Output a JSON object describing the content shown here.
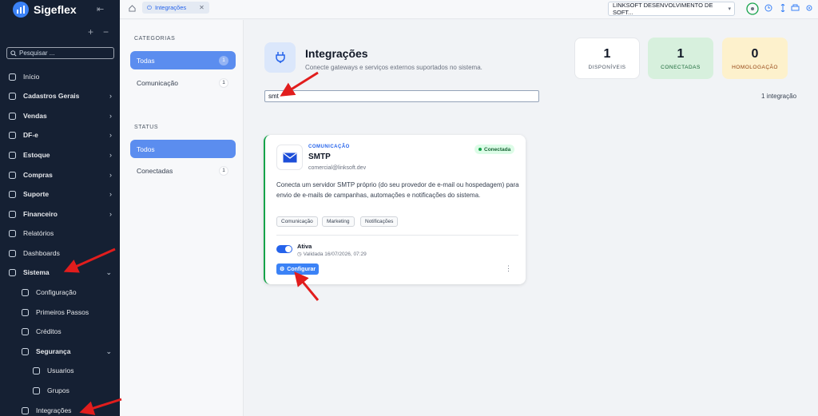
{
  "app": {
    "name": "Sigeflex"
  },
  "sidebar": {
    "search_placeholder": "Pesquisar ...",
    "items": [
      {
        "label": "Início",
        "icon": "home-icon",
        "bold": false,
        "chevron": ""
      },
      {
        "label": "Cadastros Gerais",
        "icon": "grid-icon",
        "bold": true,
        "chevron": "›"
      },
      {
        "label": "Vendas",
        "icon": "cart-icon",
        "bold": true,
        "chevron": "›"
      },
      {
        "label": "DF-e",
        "icon": "document-icon",
        "bold": true,
        "chevron": "›"
      },
      {
        "label": "Estoque",
        "icon": "box-icon",
        "bold": true,
        "chevron": "›"
      },
      {
        "label": "Compras",
        "icon": "truck-icon",
        "bold": true,
        "chevron": "›"
      },
      {
        "label": "Suporte",
        "icon": "headset-icon",
        "bold": true,
        "chevron": "›"
      },
      {
        "label": "Financeiro",
        "icon": "bank-icon",
        "bold": true,
        "chevron": "›"
      },
      {
        "label": "Relatórios",
        "icon": "report-icon",
        "bold": false,
        "chevron": ""
      },
      {
        "label": "Dashboards",
        "icon": "dashboard-icon",
        "bold": false,
        "chevron": ""
      },
      {
        "label": "Sistema",
        "icon": "gear-icon",
        "bold": true,
        "chevron": "⌄"
      },
      {
        "label": "Configuração",
        "icon": "gear-icon",
        "bold": false,
        "chevron": ""
      },
      {
        "label": "Primeiros Passos",
        "icon": "rocket-icon",
        "bold": false,
        "chevron": ""
      },
      {
        "label": "Créditos",
        "icon": "coins-icon",
        "bold": false,
        "chevron": ""
      },
      {
        "label": "Segurança",
        "icon": "shield-icon",
        "bold": true,
        "chevron": "⌄"
      },
      {
        "label": "Usuarios",
        "icon": "user-icon",
        "bold": false,
        "chevron": ""
      },
      {
        "label": "Grupos",
        "icon": "users-icon",
        "bold": false,
        "chevron": ""
      },
      {
        "label": "Integrações",
        "icon": "plug-icon",
        "bold": false,
        "chevron": ""
      }
    ]
  },
  "topbar": {
    "tab_label": "Integrações",
    "company": "LINKSOFT DESENVOLVIMENTO DE SOFT..."
  },
  "filters": {
    "categories_title": "CATEGORIAS",
    "categories": [
      {
        "label": "Todas",
        "count": "1",
        "active": true
      },
      {
        "label": "Comunicação",
        "count": "1",
        "active": false
      }
    ],
    "status_title": "STATUS",
    "status": [
      {
        "label": "Todos",
        "count": "",
        "active": true
      },
      {
        "label": "Conectadas",
        "count": "1",
        "active": false
      }
    ]
  },
  "header": {
    "title": "Integrações",
    "subtitle": "Conecte gateways e serviços externos suportados no sistema."
  },
  "stats": [
    {
      "value": "1",
      "label": "DISPONÍVEIS",
      "bg": "#ffffff",
      "color": "#4b5563"
    },
    {
      "value": "1",
      "label": "CONECTADAS",
      "bg": "#d7f0dd",
      "color": "#166534"
    },
    {
      "value": "0",
      "label": "HOMOLOGAÇÃO",
      "bg": "#fdf1cc",
      "color": "#92400e"
    }
  ],
  "search": {
    "value": "smt",
    "result_count": "1 integração"
  },
  "card": {
    "category": "COMUNICAÇÃO",
    "title": "SMTP",
    "email": "comercial@linksoft.dev",
    "status": "Conectada",
    "description": "Conecta um servidor SMTP próprio (do seu provedor de e-mail ou hospedagem) para envio de e-mails de campanhas, automações e notificações do sistema.",
    "tags": [
      "Comunicação",
      "Marketing",
      "Notificações"
    ],
    "toggle_label": "Ativa",
    "validation": "Validada 16/07/2026, 07:29",
    "configure_label": "Configurar"
  },
  "colors": {
    "accent": "#3b82f6",
    "sidebar_bg": "#152033",
    "success": "#16a34a",
    "arrow": "#e11d1d"
  }
}
